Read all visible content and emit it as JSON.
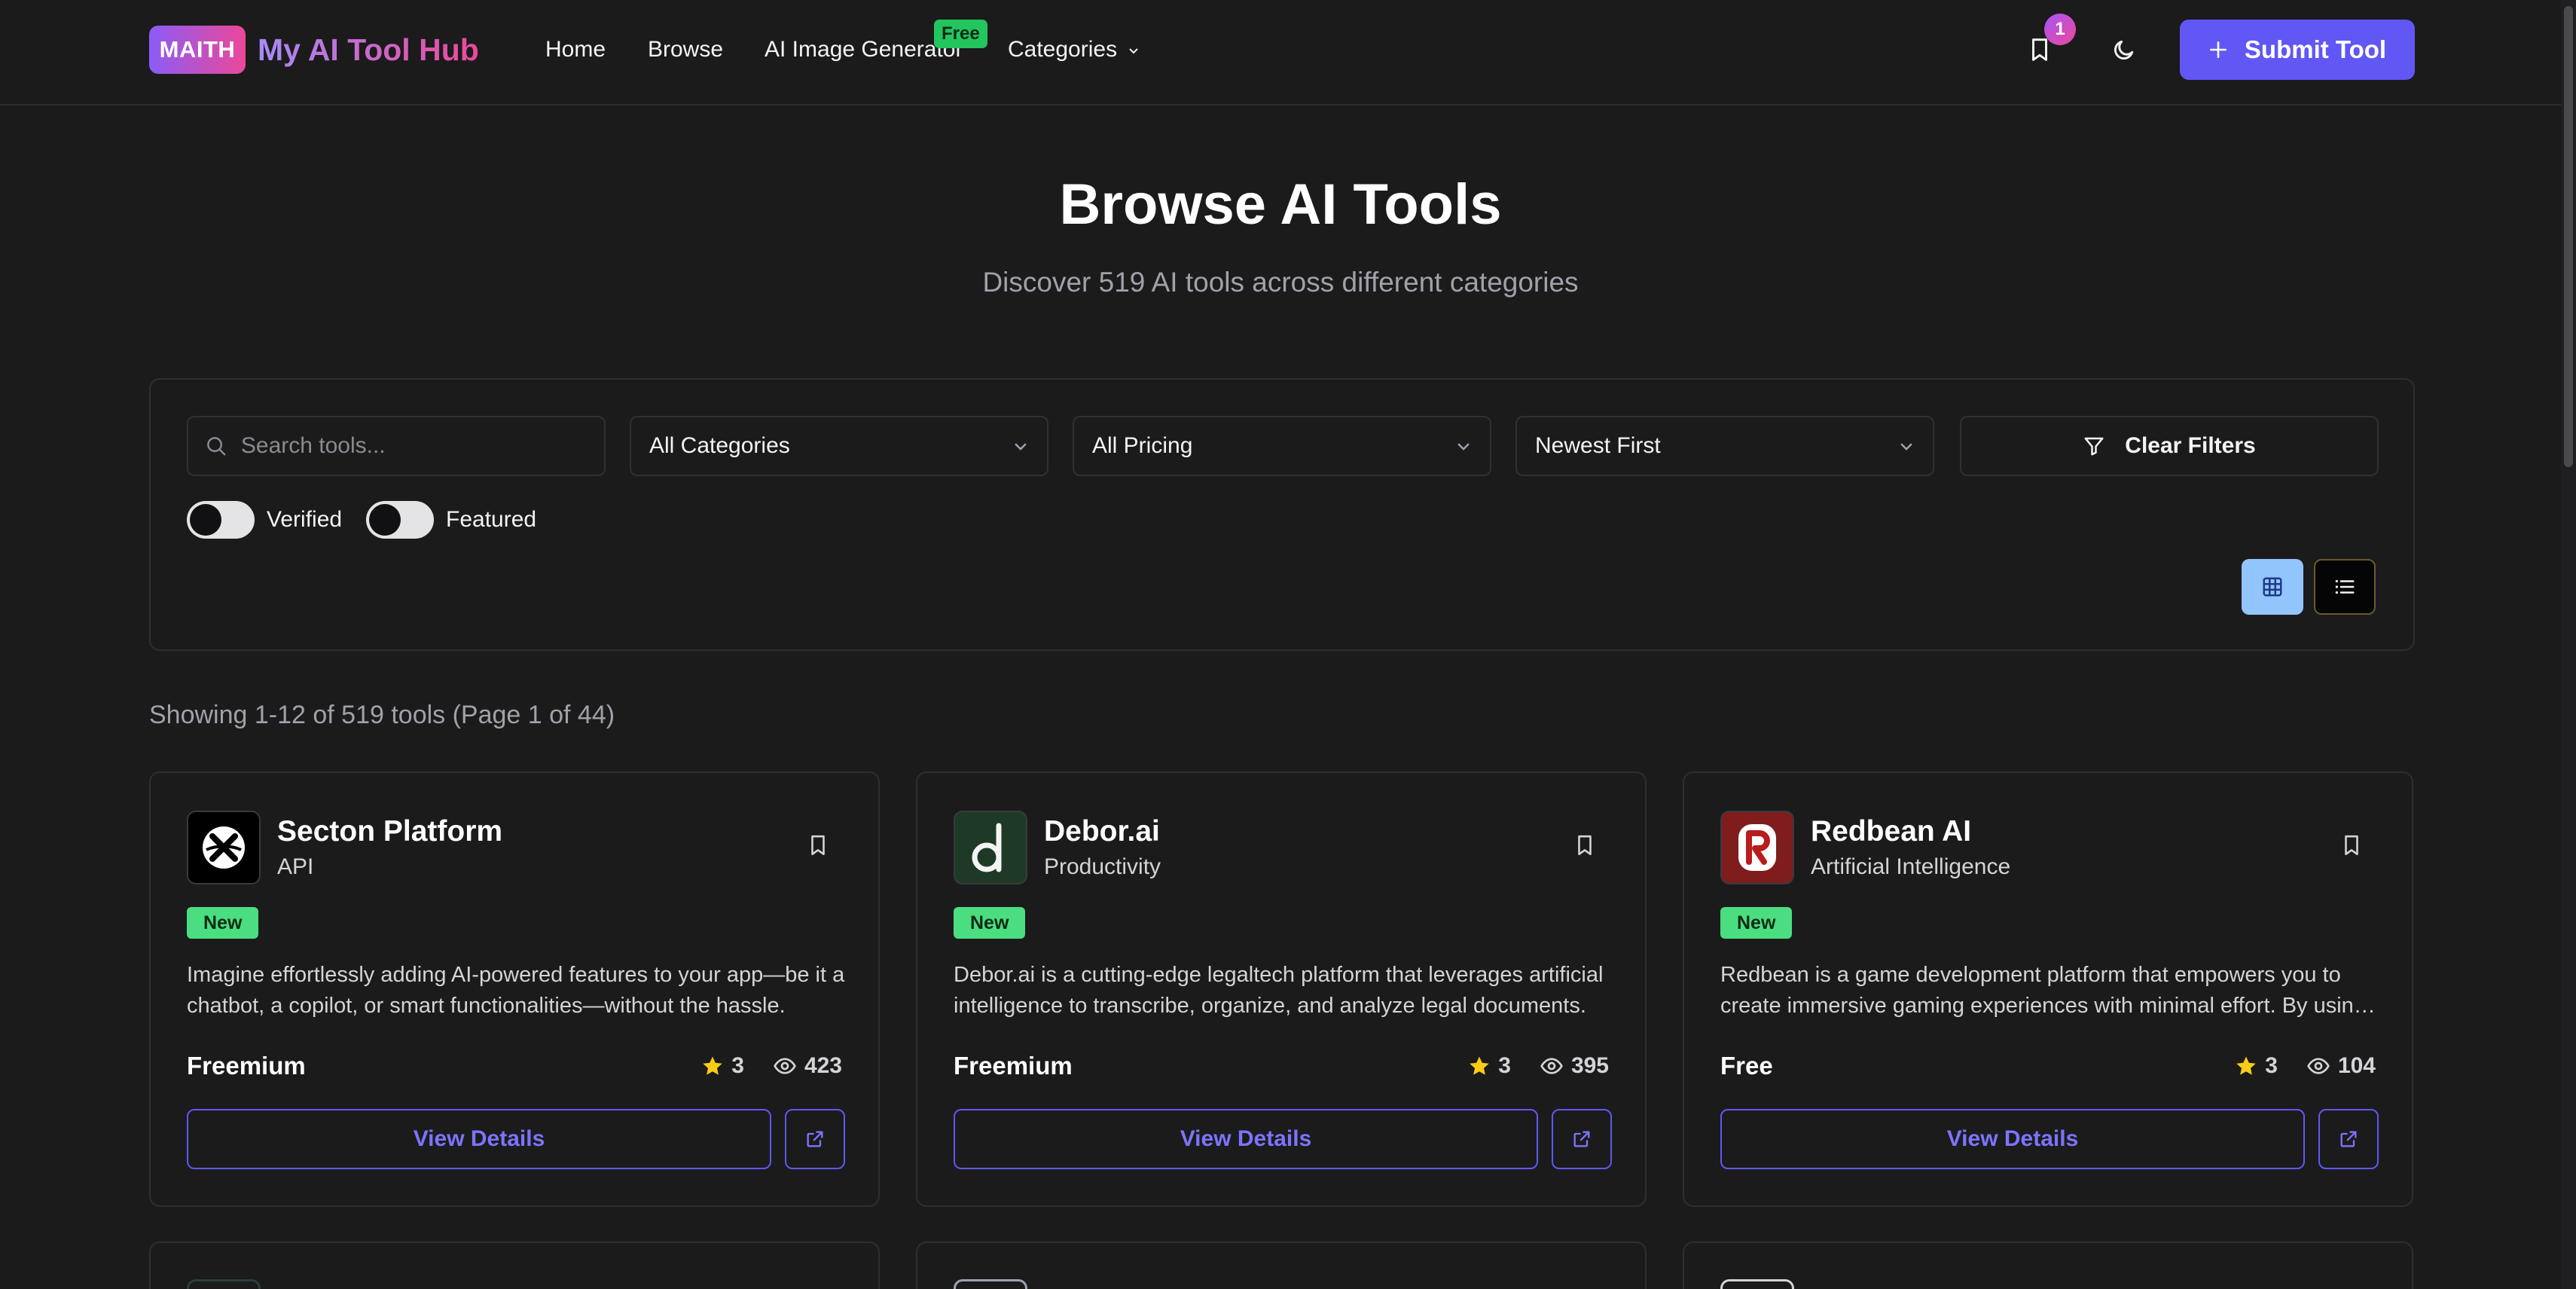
{
  "header": {
    "logo_badge": "MAITH",
    "logo_text": "My AI Tool Hub",
    "nav": {
      "home": "Home",
      "browse": "Browse",
      "ai_image_generator": "AI Image Generator",
      "free_badge": "Free",
      "categories": "Categories"
    },
    "bookmark_count": "1",
    "submit_label": "Submit Tool"
  },
  "hero": {
    "title": "Browse AI Tools",
    "subtitle": "Discover 519 AI tools across different categories"
  },
  "filters": {
    "search_placeholder": "Search tools...",
    "category": "All Categories",
    "pricing": "All Pricing",
    "sort": "Newest First",
    "clear_label": "Clear Filters",
    "verified_label": "Verified",
    "featured_label": "Featured"
  },
  "results": {
    "summary": "Showing 1-12 of 519 tools (Page 1 of 44)"
  },
  "tools": [
    {
      "name": "Secton Platform",
      "category": "API",
      "badge": "New",
      "description": "Imagine effortlessly adding AI-powered features to your app—be it a chatbot, a copilot, or smart functionalities—without the hassle.",
      "pricing": "Freemium",
      "rating": "3",
      "views": "423",
      "view_label": "View Details"
    },
    {
      "name": "Debor.ai",
      "category": "Productivity",
      "badge": "New",
      "description": "Debor.ai is a cutting-edge legaltech platform that leverages artificial intelligence to transcribe, organize, and analyze legal documents.",
      "pricing": "Freemium",
      "rating": "3",
      "views": "395",
      "view_label": "View Details"
    },
    {
      "name": "Redbean AI",
      "category": "Artificial Intelligence",
      "badge": "New",
      "description": "Redbean is a game development platform that empowers you to create immersive gaming experiences with minimal effort. By using AI.",
      "pricing": "Free",
      "rating": "3",
      "views": "104",
      "view_label": "View Details"
    }
  ],
  "colors": {
    "accent": "#6157f5",
    "new_badge": "#4ade80",
    "star": "#facc15"
  }
}
